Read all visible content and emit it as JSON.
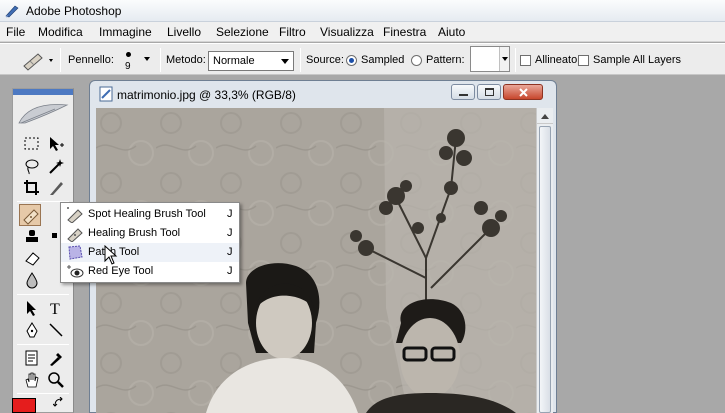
{
  "app": {
    "title": "Adobe Photoshop"
  },
  "menu": [
    "File",
    "Modifica",
    "Immagine",
    "Livello",
    "Selezione",
    "Filtro",
    "Visualizza",
    "Finestra",
    "Aiuto"
  ],
  "options": {
    "brush_label": "Pennello:",
    "brush_size": "9",
    "mode_label": "Metodo:",
    "mode_value": "Normale",
    "source_label": "Source:",
    "source_sampled": "Sampled",
    "source_pattern": "Pattern:",
    "aligned_label": "Allineato",
    "sample_all_label": "Sample All Layers"
  },
  "document": {
    "title": "matrimonio.jpg @ 33,3% (RGB/8)"
  },
  "flyout": {
    "items": [
      {
        "label": "Spot Healing Brush Tool",
        "key": "J",
        "icon": "spot-healing-brush-icon"
      },
      {
        "label": "Healing Brush Tool",
        "key": "J",
        "icon": "healing-brush-icon",
        "selected": true
      },
      {
        "label": "Patch Tool",
        "key": "J",
        "icon": "patch-icon",
        "hovered": true
      },
      {
        "label": "Red Eye Tool",
        "key": "J",
        "icon": "red-eye-icon"
      }
    ]
  },
  "colors": {
    "foreground": "#e51d1d",
    "accent": "#4d79c2"
  }
}
